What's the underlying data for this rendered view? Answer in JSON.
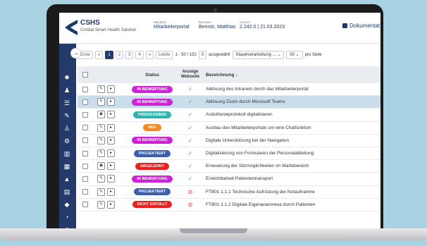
{
  "header": {
    "brand_title": "CSHS",
    "brand_subtitle": "Condat Smart Health Solution",
    "mandant_label": "Mandant",
    "mandant_value": "Mitarbeiterportal",
    "user_label": "Benutzer",
    "user_value": "Bennör, Matthias",
    "version_label": "Version",
    "version_value": "2.242.0 | 21.03.2023",
    "doc_button": "Dokumentat"
  },
  "toolbar": {
    "first": "Erste",
    "prev": "«",
    "pages": [
      "1",
      "2",
      "3",
      "4"
    ],
    "next": "»",
    "last": "Letzte",
    "range": "1 - 50 / 152",
    "selected_count": "0",
    "selected_label": "ausgewählt",
    "batch_select": "Stapelverarbeitung ...",
    "per_page_value": "50",
    "per_page_label": "pro Seite"
  },
  "table": {
    "col_status": "Status",
    "col_web": "Anzeige Webseite",
    "col_desc": "Bezeichnung ↓",
    "rows": [
      {
        "status": "IN BEWERTUNG",
        "desc": "Ablösung des Intranets durch das Mitarbeiterportal"
      },
      {
        "status": "IN BEWERTUNG",
        "desc": "Ablösung Zoom durch Microsoft Teams"
      },
      {
        "status": "FREIGEGEBEN",
        "desc": "Anästhesieprotokoll digitalisieren"
      },
      {
        "status": "NEU",
        "desc": "Ausbau des Mitarbeiterportals um eine Chatfunktion"
      },
      {
        "status": "IN BEWERTUNG",
        "desc": "Digitale Unterstützung bei der Navigation"
      },
      {
        "status": "PROJEKTIERT",
        "desc": "Digitalisierung von Formularen der Personalabteilung"
      },
      {
        "status": "ABGELEHNT",
        "desc": "Erneuerung der Sitzmöglichkeiten im Wartebereich"
      },
      {
        "status": "IN BEWERTUNG",
        "desc": "Erreichbarkeit Patiententransport"
      },
      {
        "status": "PROJEKTIERT",
        "desc": "FTB01 1.1.1 Technische Aufrüstung der Notaufnahme"
      },
      {
        "status": "NICHT ERFÜLLT",
        "desc": "FTB01 1.1.2 Digitale Eigenanamnese durch Patienten"
      }
    ]
  },
  "colors": {
    "in_bewertung": "#d020d8",
    "freigegeben": "#2bb5ac",
    "neu": "#f5891f",
    "projektiert": "#3d5faa",
    "abgelehnt": "#e8201f",
    "nicht_erfuellt": "#e8201f",
    "sidebar": "#243a6a"
  }
}
